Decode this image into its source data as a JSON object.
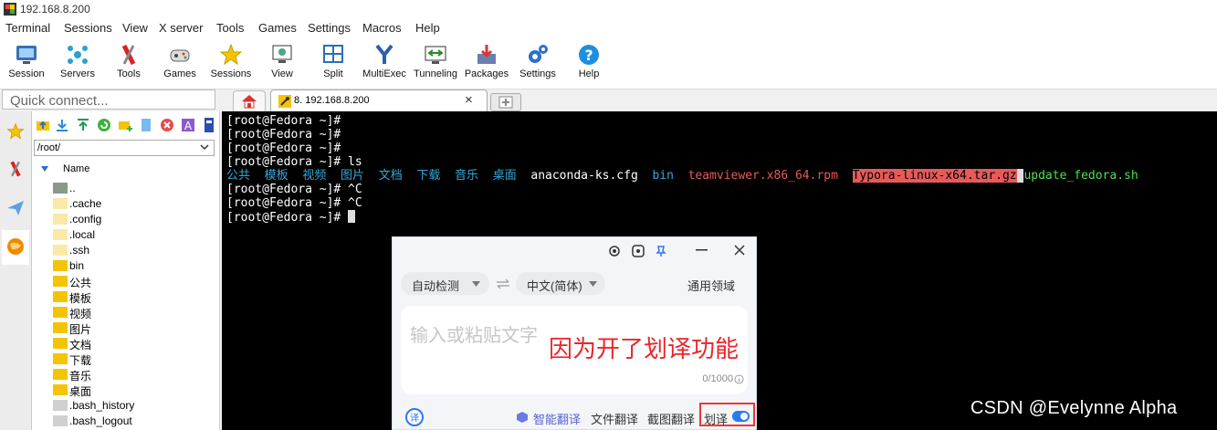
{
  "window": {
    "title": "192.168.8.200"
  },
  "menu": [
    "Terminal",
    "Sessions",
    "View",
    "X server",
    "Tools",
    "Games",
    "Settings",
    "Macros",
    "Help"
  ],
  "toolbar": [
    {
      "label": "Session",
      "icon": "session-icon"
    },
    {
      "label": "Servers",
      "icon": "servers-icon"
    },
    {
      "label": "Tools",
      "icon": "tools-icon"
    },
    {
      "label": "Games",
      "icon": "games-icon"
    },
    {
      "label": "Sessions",
      "icon": "sessions-star-icon"
    },
    {
      "label": "View",
      "icon": "view-icon"
    },
    {
      "label": "Split",
      "icon": "split-icon"
    },
    {
      "label": "MultiExec",
      "icon": "multiexec-icon"
    },
    {
      "label": "Tunneling",
      "icon": "tunneling-icon"
    },
    {
      "label": "Packages",
      "icon": "packages-icon"
    },
    {
      "label": "Settings",
      "icon": "settings-gear-icon"
    },
    {
      "label": "Help",
      "icon": "help-icon"
    }
  ],
  "quick_connect": {
    "placeholder": "Quick connect..."
  },
  "tabs": {
    "session": "8. 192.168.8.200",
    "close": "×"
  },
  "file_browser": {
    "path": "/root/",
    "column": "Name",
    "files": [
      {
        "name": "..",
        "type": "parent"
      },
      {
        "name": ".cache",
        "type": "folder-hidden"
      },
      {
        "name": ".config",
        "type": "folder-hidden"
      },
      {
        "name": ".local",
        "type": "folder-hidden"
      },
      {
        "name": ".ssh",
        "type": "folder-hidden"
      },
      {
        "name": "bin",
        "type": "folder"
      },
      {
        "name": "公共",
        "type": "folder"
      },
      {
        "name": "模板",
        "type": "folder"
      },
      {
        "name": "视频",
        "type": "folder"
      },
      {
        "name": "图片",
        "type": "folder"
      },
      {
        "name": "文档",
        "type": "folder"
      },
      {
        "name": "下载",
        "type": "folder"
      },
      {
        "name": "音乐",
        "type": "folder"
      },
      {
        "name": "桌面",
        "type": "folder"
      },
      {
        "name": ".bash_history",
        "type": "file"
      },
      {
        "name": ".bash_logout",
        "type": "file"
      }
    ]
  },
  "terminal": {
    "prompt": "[root@Fedora ~]#",
    "line4_cmd": " ls",
    "ls_dirs": [
      "公共",
      "模板",
      "视频",
      "图片",
      "文档",
      "下载",
      "音乐",
      "桌面"
    ],
    "ls_file": "anaconda-ks.cfg",
    "ls_bin": "bin",
    "ls_rpm": "teamviewer.x86_64.rpm",
    "ls_tar": "Typora-linux-x64.tar.gz",
    "ls_sh": "update_fedora.sh",
    "ctrl_c": " ^C"
  },
  "translator": {
    "source_lang": "自动检测",
    "target_lang": "中文(简体)",
    "domain": "通用领域",
    "placeholder": "输入或粘贴文字",
    "counter": "0/1000",
    "bottom": {
      "smart": "智能翻译",
      "doc": "文件翻译",
      "image": "截图翻译",
      "hover": "划译"
    },
    "hover_toggle_on": true
  },
  "annotation": "因为开了划译功能",
  "watermark": "CSDN @Evelynne Alpha"
}
